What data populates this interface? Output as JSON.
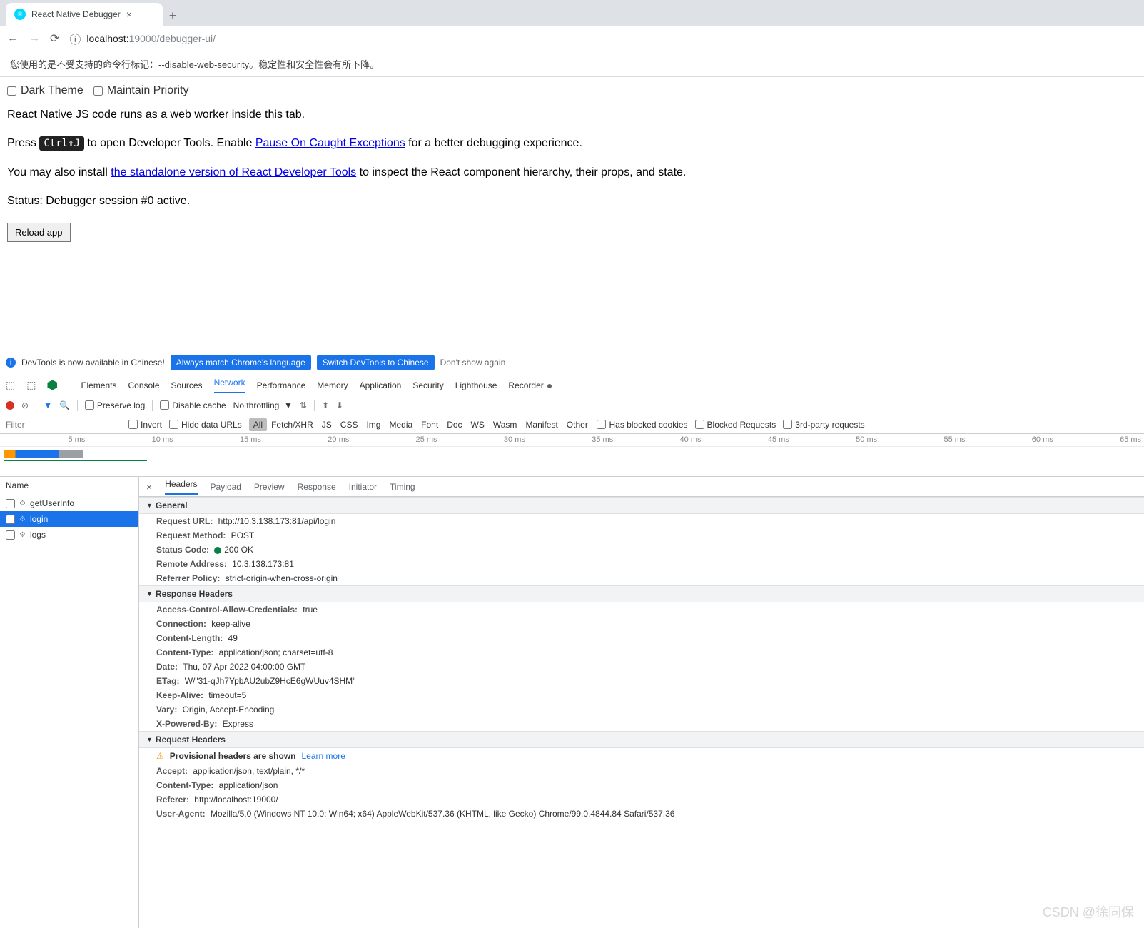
{
  "browser": {
    "tab_title": "React Native Debugger",
    "url_host": "localhost:",
    "url_port": "19000",
    "url_path": "/debugger-ui/"
  },
  "infobar": "您使用的是不受支持的命令行标记：--disable-web-security。稳定性和安全性会有所下降。",
  "page": {
    "dark_theme": "Dark Theme",
    "maintain_priority": "Maintain Priority",
    "line1": "React Native JS code runs as a web worker inside this tab.",
    "press": "Press",
    "kbd": "Ctrl⇧J",
    "line2a": " to open Developer Tools. Enable ",
    "link1": "Pause On Caught Exceptions",
    "line2b": " for a better debugging experience.",
    "line3a": "You may also install ",
    "link2": "the standalone version of React Developer Tools",
    "line3b": " to inspect the React component hierarchy, their props, and state.",
    "status": "Status: Debugger session #0 active.",
    "reload": "Reload app"
  },
  "devtools": {
    "banner_text": "DevTools is now available in Chinese!",
    "btn_match": "Always match Chrome's language",
    "btn_switch": "Switch DevTools to Chinese",
    "dont_show": "Don't show again",
    "tabs": [
      "Elements",
      "Console",
      "Sources",
      "Network",
      "Performance",
      "Memory",
      "Application",
      "Security",
      "Lighthouse",
      "Recorder"
    ],
    "active_tab": "Network",
    "toolbar": {
      "preserve_log": "Preserve log",
      "disable_cache": "Disable cache",
      "throttling": "No throttling"
    },
    "filter_placeholder": "Filter",
    "filters": {
      "invert": "Invert",
      "hide_data": "Hide data URLs",
      "types": [
        "All",
        "Fetch/XHR",
        "JS",
        "CSS",
        "Img",
        "Media",
        "Font",
        "Doc",
        "WS",
        "Wasm",
        "Manifest",
        "Other"
      ],
      "blocked_cookies": "Has blocked cookies",
      "blocked_req": "Blocked Requests",
      "third_party": "3rd-party requests"
    },
    "timeline_ticks": [
      "5 ms",
      "10 ms",
      "15 ms",
      "20 ms",
      "25 ms",
      "30 ms",
      "35 ms",
      "40 ms",
      "45 ms",
      "50 ms",
      "55 ms",
      "60 ms",
      "65 ms"
    ],
    "name_header": "Name",
    "requests": [
      {
        "name": "getUserInfo"
      },
      {
        "name": "login"
      },
      {
        "name": "logs"
      }
    ],
    "selected_request": 1,
    "detail_tabs": [
      "Headers",
      "Payload",
      "Preview",
      "Response",
      "Initiator",
      "Timing"
    ],
    "active_detail_tab": "Headers",
    "general_hdr": "General",
    "general": [
      {
        "k": "Request URL:",
        "v": "http://10.3.138.173:81/api/login"
      },
      {
        "k": "Request Method:",
        "v": "POST"
      },
      {
        "k": "Status Code:",
        "v": "200 OK",
        "status": true
      },
      {
        "k": "Remote Address:",
        "v": "10.3.138.173:81"
      },
      {
        "k": "Referrer Policy:",
        "v": "strict-origin-when-cross-origin"
      }
    ],
    "response_hdr": "Response Headers",
    "response_headers": [
      {
        "k": "Access-Control-Allow-Credentials:",
        "v": "true"
      },
      {
        "k": "Connection:",
        "v": "keep-alive"
      },
      {
        "k": "Content-Length:",
        "v": "49"
      },
      {
        "k": "Content-Type:",
        "v": "application/json; charset=utf-8"
      },
      {
        "k": "Date:",
        "v": "Thu, 07 Apr 2022 04:00:00 GMT"
      },
      {
        "k": "ETag:",
        "v": "W/\"31-qJh7YpbAU2ubZ9HcE6gWUuv4SHM\""
      },
      {
        "k": "Keep-Alive:",
        "v": "timeout=5"
      },
      {
        "k": "Vary:",
        "v": "Origin, Accept-Encoding"
      },
      {
        "k": "X-Powered-By:",
        "v": "Express"
      }
    ],
    "request_hdr": "Request Headers",
    "provisional": "Provisional headers are shown",
    "learn_more": "Learn more",
    "request_headers": [
      {
        "k": "Accept:",
        "v": "application/json, text/plain, */*"
      },
      {
        "k": "Content-Type:",
        "v": "application/json"
      },
      {
        "k": "Referer:",
        "v": "http://localhost:19000/"
      },
      {
        "k": "User-Agent:",
        "v": "Mozilla/5.0 (Windows NT 10.0; Win64; x64) AppleWebKit/537.36 (KHTML, like Gecko) Chrome/99.0.4844.84 Safari/537.36"
      }
    ]
  },
  "watermark": "CSDN @徐同保"
}
